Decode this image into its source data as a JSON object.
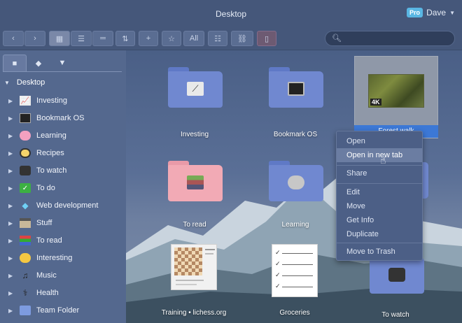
{
  "window": {
    "title": "Desktop"
  },
  "user": {
    "badge": "Pro",
    "name": "Dave"
  },
  "toolbar": {
    "all_label": "All",
    "search_placeholder": ""
  },
  "sidebar": {
    "root": "Desktop",
    "items": [
      {
        "label": "Investing",
        "icon": "chart-icon"
      },
      {
        "label": "Bookmark OS",
        "icon": "computer-icon"
      },
      {
        "label": "Learning",
        "icon": "brain-icon"
      },
      {
        "label": "Recipes",
        "icon": "pan-icon"
      },
      {
        "label": "To watch",
        "icon": "tv-icon"
      },
      {
        "label": "To do",
        "icon": "checkmark-icon"
      },
      {
        "label": "Web development",
        "icon": "diamond-icon"
      },
      {
        "label": "Stuff",
        "icon": "box-icon"
      },
      {
        "label": "To read",
        "icon": "books-icon"
      },
      {
        "label": "Interesting",
        "icon": "thinking-face-icon"
      },
      {
        "label": "Music",
        "icon": "music-note-icon"
      },
      {
        "label": "Health",
        "icon": "caduceus-icon"
      },
      {
        "label": "Team Folder",
        "icon": "folder-icon"
      }
    ]
  },
  "main": {
    "tiles": [
      {
        "label": "Investing"
      },
      {
        "label": "Bookmark OS"
      },
      {
        "label": "Forest walk"
      },
      {
        "label": "To read"
      },
      {
        "label": "Learning"
      },
      {
        "label": "Training • lichess.org"
      },
      {
        "label": "Groceries"
      },
      {
        "label": "To watch"
      }
    ],
    "video_badge": "4K"
  },
  "context_menu": {
    "items": [
      "Open",
      "Open in new tab",
      "Share",
      "Edit",
      "Move",
      "Get Info",
      "Duplicate",
      "Move to Trash"
    ],
    "active_index": 1
  },
  "colors": {
    "accent": "#3c78d6",
    "folder_blue": "#6f87cf",
    "folder_pink": "#f2a8b4",
    "pro_badge": "#59b6e3"
  }
}
